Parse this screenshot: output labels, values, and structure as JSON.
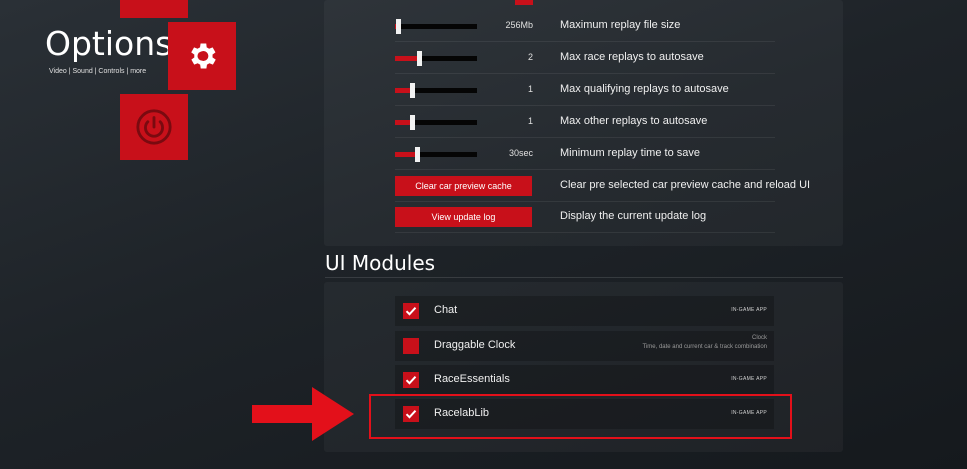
{
  "sidebar": {
    "title": "Options",
    "subtitle": "Video | Sound | Controls | more",
    "items": [
      {
        "icon": "gear-icon"
      },
      {
        "icon": "power-icon"
      }
    ]
  },
  "replay_settings": {
    "rows": [
      {
        "value": "256Mb",
        "label": "Maximum replay file size",
        "level": 0.03
      },
      {
        "value": "2",
        "label": "Max race replays to autosave",
        "level": 0.28
      },
      {
        "value": "1",
        "label": "Max qualifying replays to autosave",
        "level": 0.18
      },
      {
        "value": "1",
        "label": "Max other replays to autosave",
        "level": 0.18
      },
      {
        "value": "30sec",
        "label": "Minimum replay time to save",
        "level": 0.25
      }
    ],
    "buttons": [
      {
        "label": "Clear car preview cache",
        "description": "Clear pre selected car preview cache and reload UI"
      },
      {
        "label": "View update log",
        "description": "Display the current update log"
      }
    ]
  },
  "ui_modules": {
    "title": "UI Modules",
    "items": [
      {
        "name": "Chat",
        "checked": true,
        "tag": "IN-GAME APP"
      },
      {
        "name": "Draggable Clock",
        "checked": false,
        "tag": "Clock",
        "tag_detail": "Time, date and current car & track combination"
      },
      {
        "name": "RaceEssentials",
        "checked": true,
        "tag": "IN-GAME APP"
      },
      {
        "name": "RacelabLib",
        "checked": true,
        "tag": "IN-GAME APP"
      }
    ]
  },
  "colors": {
    "accent": "#c8101a",
    "annotation": "#e3101a"
  }
}
